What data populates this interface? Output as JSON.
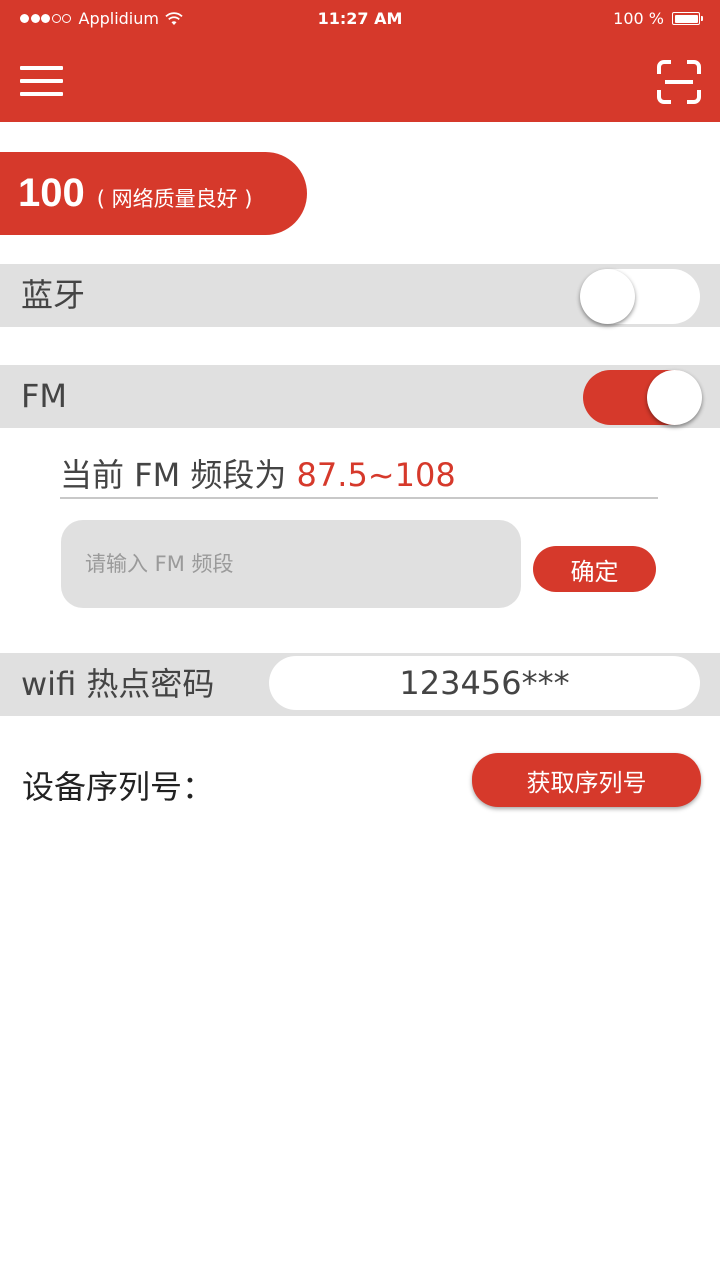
{
  "status_bar": {
    "carrier": "Applidium",
    "time": "11:27 AM",
    "battery": "100 %"
  },
  "header": {
    "menu_icon": "hamburger-menu-icon",
    "scan_icon": "scan-icon"
  },
  "score": {
    "value": "100",
    "description": "( 网络质量良好 )"
  },
  "bluetooth": {
    "label": "蓝牙",
    "enabled": false
  },
  "fm": {
    "label": "FM",
    "enabled": true,
    "current_prefix": "当前 FM 频段为 ",
    "current_range": "87.5~108",
    "input_placeholder": "请输入 FM 频段",
    "input_value": "",
    "confirm_label": "确定"
  },
  "wifi": {
    "label": "wifi 热点密码",
    "password": "123456***"
  },
  "serial": {
    "label": "设备序列号：",
    "button_label": "获取序列号"
  },
  "colors": {
    "accent": "#d6392b",
    "row_background": "#e0e0e0"
  }
}
